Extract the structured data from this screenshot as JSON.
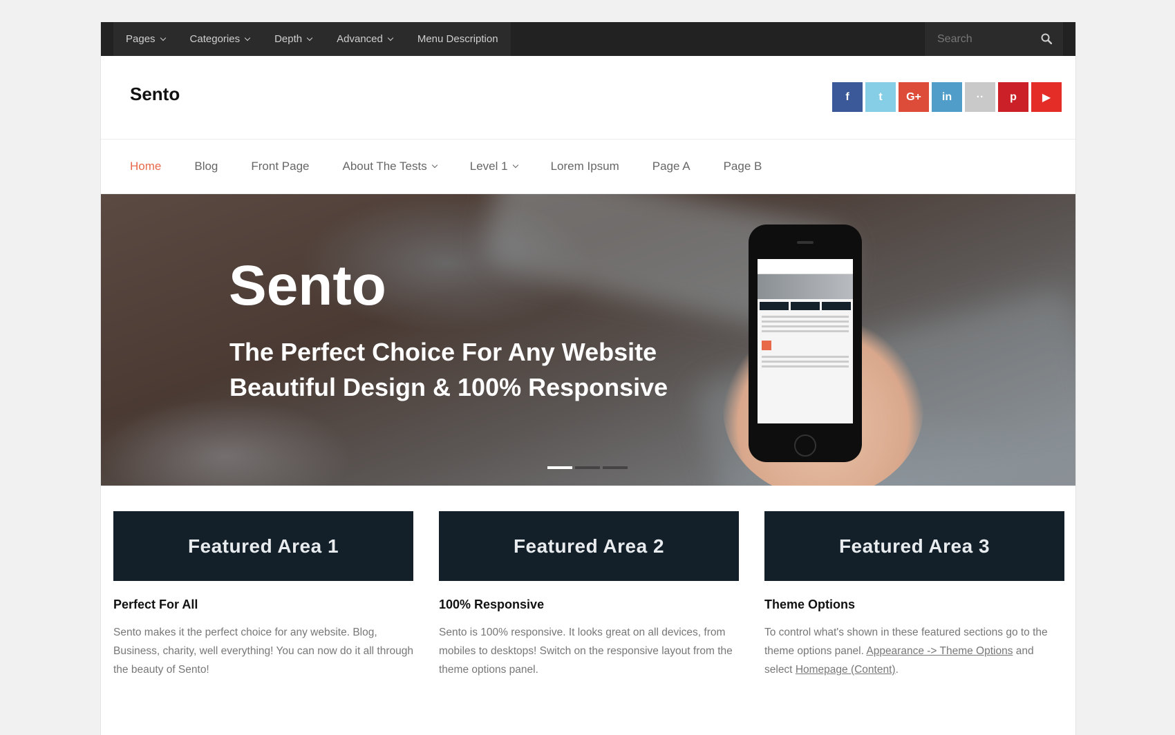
{
  "topbar": {
    "menu": [
      {
        "label": "Pages",
        "dropdown": true
      },
      {
        "label": "Categories",
        "dropdown": true
      },
      {
        "label": "Depth",
        "dropdown": true
      },
      {
        "label": "Advanced",
        "dropdown": true
      },
      {
        "label": "Menu Description",
        "dropdown": false
      }
    ],
    "search_placeholder": "Search"
  },
  "header": {
    "site_title": "Sento",
    "socials": [
      {
        "name": "facebook",
        "glyph": "f",
        "color": "#3b5998"
      },
      {
        "name": "twitter",
        "glyph": "t",
        "color": "#86cde6"
      },
      {
        "name": "google-plus",
        "glyph": "G+",
        "color": "#dd4b39"
      },
      {
        "name": "linkedin",
        "glyph": "in",
        "color": "#4f9dc8"
      },
      {
        "name": "flickr",
        "glyph": "··",
        "color": "#c9c9c9"
      },
      {
        "name": "pinterest",
        "glyph": "p",
        "color": "#cb2027"
      },
      {
        "name": "youtube",
        "glyph": "▶",
        "color": "#e52d27"
      }
    ]
  },
  "nav": {
    "items": [
      {
        "label": "Home",
        "active": true,
        "dropdown": false
      },
      {
        "label": "Blog",
        "active": false,
        "dropdown": false
      },
      {
        "label": "Front Page",
        "active": false,
        "dropdown": false
      },
      {
        "label": "About The Tests",
        "active": false,
        "dropdown": true
      },
      {
        "label": "Level 1",
        "active": false,
        "dropdown": true
      },
      {
        "label": "Lorem Ipsum",
        "active": false,
        "dropdown": false
      },
      {
        "label": "Page A",
        "active": false,
        "dropdown": false
      },
      {
        "label": "Page B",
        "active": false,
        "dropdown": false
      }
    ]
  },
  "hero": {
    "title": "Sento",
    "line1": "The Perfect Choice For Any Website",
    "line2": "Beautiful Design & 100% Responsive",
    "slides": 3,
    "active_slide": 0
  },
  "features": [
    {
      "header": "Featured Area 1",
      "title": "Perfect For All",
      "text": "Sento makes it the perfect choice for any website. Blog, Business, charity, well everything! You can now do it all through the beauty of Sento!"
    },
    {
      "header": "Featured Area 2",
      "title": "100% Responsive",
      "text": "Sento is 100% responsive. It looks great on all devices, from mobiles to desktops! Switch on the responsive layout from the theme options panel."
    },
    {
      "header": "Featured Area 3",
      "title": "Theme Options",
      "text_before": "To control what's shown in these featured sections go to the theme options panel.",
      "link1": "Appearance -> Theme Options",
      "text_mid": "and select",
      "link2": "Homepage (Content)",
      "text_end": "."
    }
  ],
  "colors": {
    "accent": "#e8684a",
    "feature_bg": "#13202a",
    "topbar_bg": "#222222"
  }
}
